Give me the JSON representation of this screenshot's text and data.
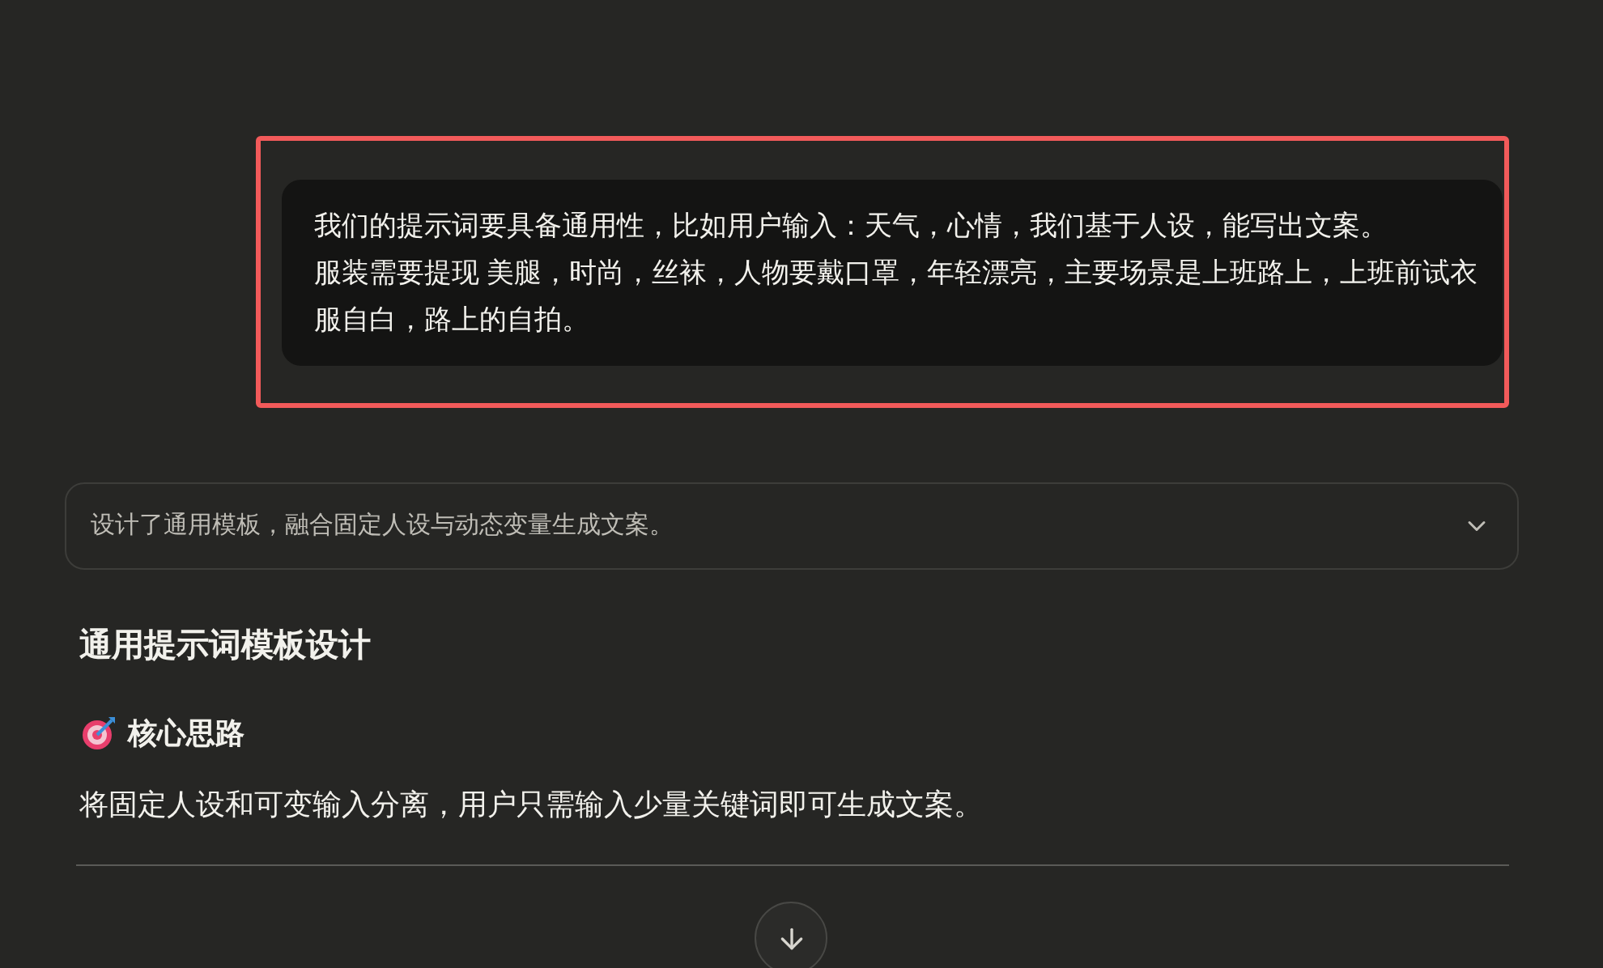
{
  "user_message": {
    "lines": [
      "我们的提示词要具备通用性，比如用户输入：天气，心情，我们基于人设，能写出文案。",
      "服装需要提现 美腿，时尚，丝袜，人物要戴口罩，年轻漂亮，主要场景是上班路上，上班前试衣服自白，路上的自拍。"
    ],
    "highlighted": true
  },
  "thinking_summary": {
    "text": "设计了通用模板，融合固定人设与动态变量生成文案。",
    "expanded": false
  },
  "heading": "通用提示词模板设计",
  "section_title": "核心思路",
  "paragraph": "将固定人设和可变输入分离，用户只需输入少量关键词即可生成文案。"
}
